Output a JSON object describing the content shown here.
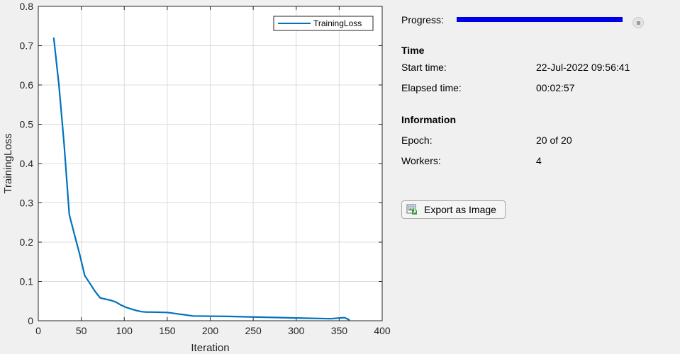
{
  "chart_data": {
    "type": "line",
    "xlabel": "Iteration",
    "ylabel": "TrainingLoss",
    "xlim": [
      0,
      400
    ],
    "ylim": [
      0,
      0.8
    ],
    "xticks": [
      0,
      50,
      100,
      150,
      200,
      250,
      300,
      350,
      400
    ],
    "yticks": [
      0,
      0.1,
      0.2,
      0.3,
      0.4,
      0.5,
      0.6,
      0.7,
      0.8
    ],
    "xtick_labels": [
      "0",
      "50",
      "100",
      "150",
      "200",
      "250",
      "300",
      "350",
      "400"
    ],
    "ytick_labels": [
      "0",
      "0.1",
      "0.2",
      "0.3",
      "0.4",
      "0.5",
      "0.6",
      "0.7",
      "0.8"
    ],
    "grid": true,
    "legend": "top-right",
    "series": [
      {
        "name": "TrainingLoss",
        "color": "#0072bd",
        "x": [
          18,
          24,
          30,
          36,
          42,
          48,
          54,
          60,
          66,
          72,
          78,
          84,
          90,
          96,
          102,
          108,
          114,
          120,
          126,
          132,
          150,
          180,
          220,
          260,
          300,
          340,
          356,
          360,
          362
        ],
        "y": [
          0.72,
          0.6,
          0.45,
          0.27,
          0.22,
          0.17,
          0.115,
          0.095,
          0.075,
          0.058,
          0.055,
          0.052,
          0.048,
          0.04,
          0.034,
          0.03,
          0.026,
          0.023,
          0.022,
          0.022,
          0.021,
          0.012,
          0.011,
          0.009,
          0.007,
          0.005,
          0.008,
          0.004,
          0.002
        ]
      }
    ]
  },
  "panel": {
    "progress_label": "Progress:",
    "progress_fraction": 1.0,
    "time_title": "Time",
    "start_time_label": "Start time:",
    "start_time_value": "22-Jul-2022 09:56:41",
    "elapsed_label": "Elapsed time:",
    "elapsed_value": "00:02:57",
    "info_title": "Information",
    "epoch_label": "Epoch:",
    "epoch_value": "20 of 20",
    "workers_label": "Workers:",
    "workers_value": "4",
    "export_label": "Export as Image",
    "export_icon": "image-export-icon",
    "stop_icon": "stop-icon"
  }
}
